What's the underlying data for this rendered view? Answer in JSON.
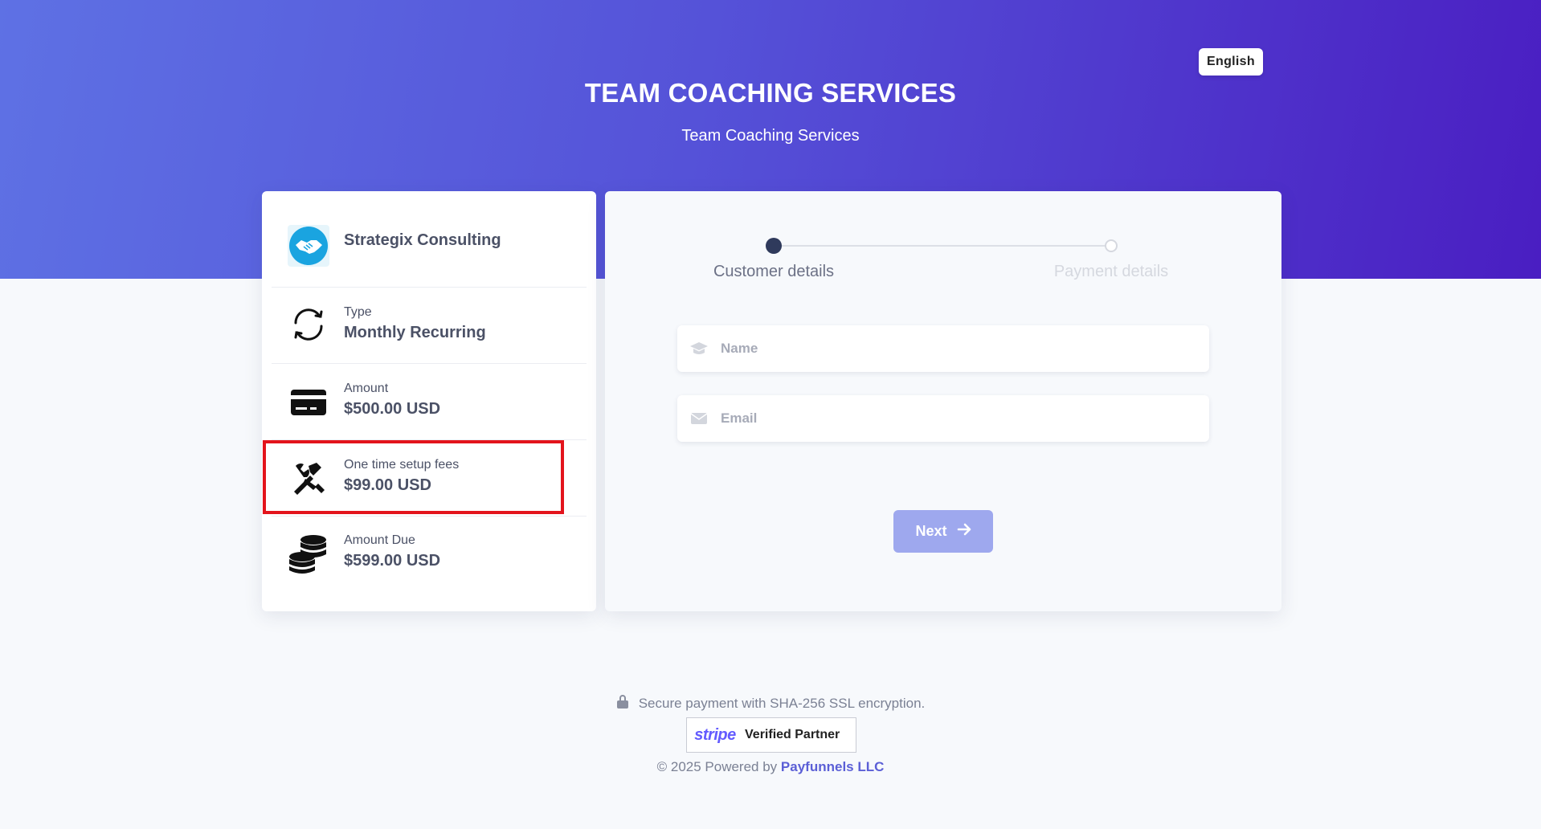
{
  "header": {
    "language_button": "English",
    "title": "TEAM COACHING SERVICES",
    "subtitle": "Team Coaching Services"
  },
  "summary": {
    "company_name": "Strategix Consulting",
    "type": {
      "label": "Type",
      "value": "Monthly Recurring"
    },
    "amount": {
      "label": "Amount",
      "value": "$500.00 USD"
    },
    "setup_fee": {
      "label": "One time setup fees",
      "value": "$99.00 USD"
    },
    "amount_due": {
      "label": "Amount Due",
      "value": "$599.00 USD"
    }
  },
  "steps": {
    "step1": "Customer details",
    "step2": "Payment details"
  },
  "form": {
    "name_placeholder": "Name",
    "email_placeholder": "Email",
    "next_label": "Next"
  },
  "footer": {
    "secure_text": "Secure payment with SHA-256 SSL encryption.",
    "stripe_logo": "stripe",
    "stripe_badge": "Verified Partner",
    "copyright_prefix": "© 2025 Powered by",
    "company_link": "Payfunnels LLC"
  },
  "colors": {
    "accent": "#5b5fd6",
    "highlight_border": "#e3141c",
    "next_button": "#9ea8ee"
  }
}
